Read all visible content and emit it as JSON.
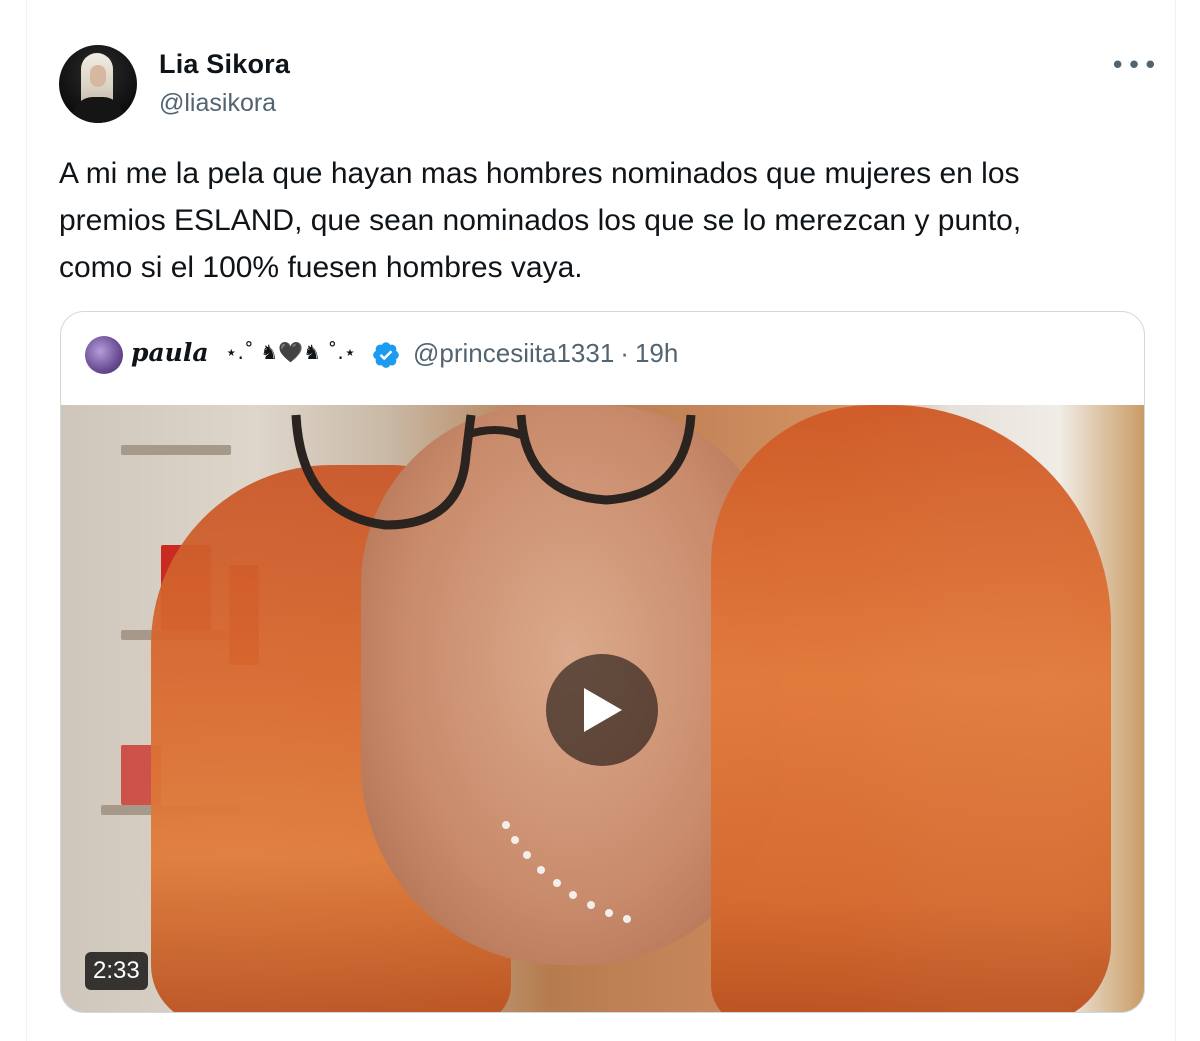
{
  "tweet": {
    "author_name": "Lia Sikora",
    "author_handle": "@liasikora",
    "more_label": "•••",
    "text_lines": [
      "A mi me la pela que hayan mas hombres nominados que mujeres en los",
      "premios ESLAND, que sean nominados los que se lo merezcan y punto,",
      "como si el 100% fuesen hombres vaya."
    ]
  },
  "quoted": {
    "author_name": "paula",
    "name_decoration": "⋆.˚ ♞🖤♞ ˚.⋆",
    "verified": true,
    "author_handle": "@princesiita1331",
    "separator": "·",
    "time": "19h",
    "video": {
      "duration": "2:33"
    }
  },
  "colors": {
    "text_primary": "#0f1419",
    "text_secondary": "#536471",
    "border": "#cfd9de",
    "verified_blue": "#1d9bf0"
  },
  "icons": [
    "more-icon",
    "verified-icon",
    "play-icon"
  ]
}
